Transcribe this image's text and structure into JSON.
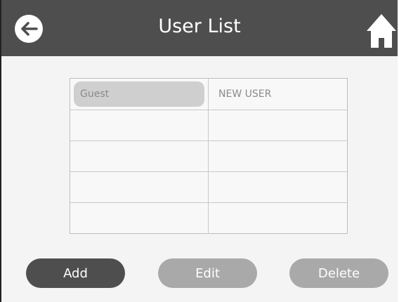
{
  "header": {
    "title": "User List",
    "back_icon": "arrow-left-icon",
    "home_icon": "home-icon"
  },
  "user_table": {
    "rows": [
      {
        "left": "Guest",
        "right": "NEW USER",
        "selected": true
      },
      {
        "left": "",
        "right": ""
      },
      {
        "left": "",
        "right": ""
      },
      {
        "left": "",
        "right": ""
      },
      {
        "left": "",
        "right": ""
      }
    ]
  },
  "actions": {
    "add_label": "Add",
    "edit_label": "Edit",
    "delete_label": "Delete"
  },
  "colors": {
    "header_bg": "#4e4e4e",
    "primary_button": "#4e4e4e",
    "disabled_button": "#a9a9a9",
    "selected_cell": "#cfcfcf"
  }
}
